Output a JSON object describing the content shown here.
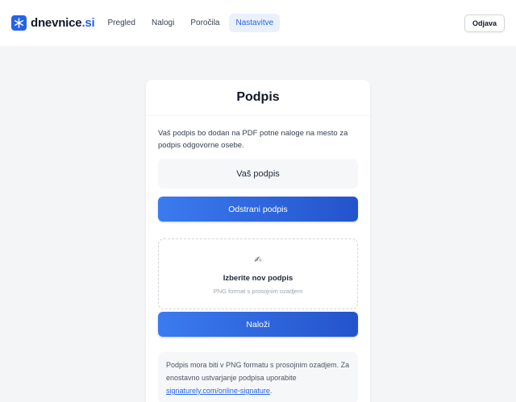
{
  "brand": {
    "name": "dnevnice",
    "tld": ".si",
    "icon": "snowflake-icon",
    "color": "#2563eb"
  },
  "nav": {
    "items": [
      {
        "label": "Pregled"
      },
      {
        "label": "Nalogi"
      },
      {
        "label": "Poročila"
      },
      {
        "label": "Nastavitve",
        "active": true
      }
    ]
  },
  "header": {
    "logout_label": "Odjava"
  },
  "card": {
    "title": "Podpis",
    "intro": "Vaš podpis bo dodan na PDF potne naloge na mesto za podpis odgovorne osebe.",
    "preview_label": "Vaš podpis",
    "remove_button": "Odstrani podpis",
    "dropzone": {
      "icon": "pen-icon",
      "title": "Izberite nov podpis",
      "subtitle": "PNG format s prosojnim ozadjem"
    },
    "upload_button": "Naloži",
    "note_text": "Podpis mora biti v PNG formatu s prosojnim ozadjem. Za enostavno ustvarjanje podpisa uporabite ",
    "note_link": "signaturely.com/online-signature",
    "note_end": "."
  },
  "colors": {
    "accent": "#2563eb",
    "button_start": "#3b7bef",
    "button_end": "#2453cc",
    "background": "#f4f5f7"
  }
}
